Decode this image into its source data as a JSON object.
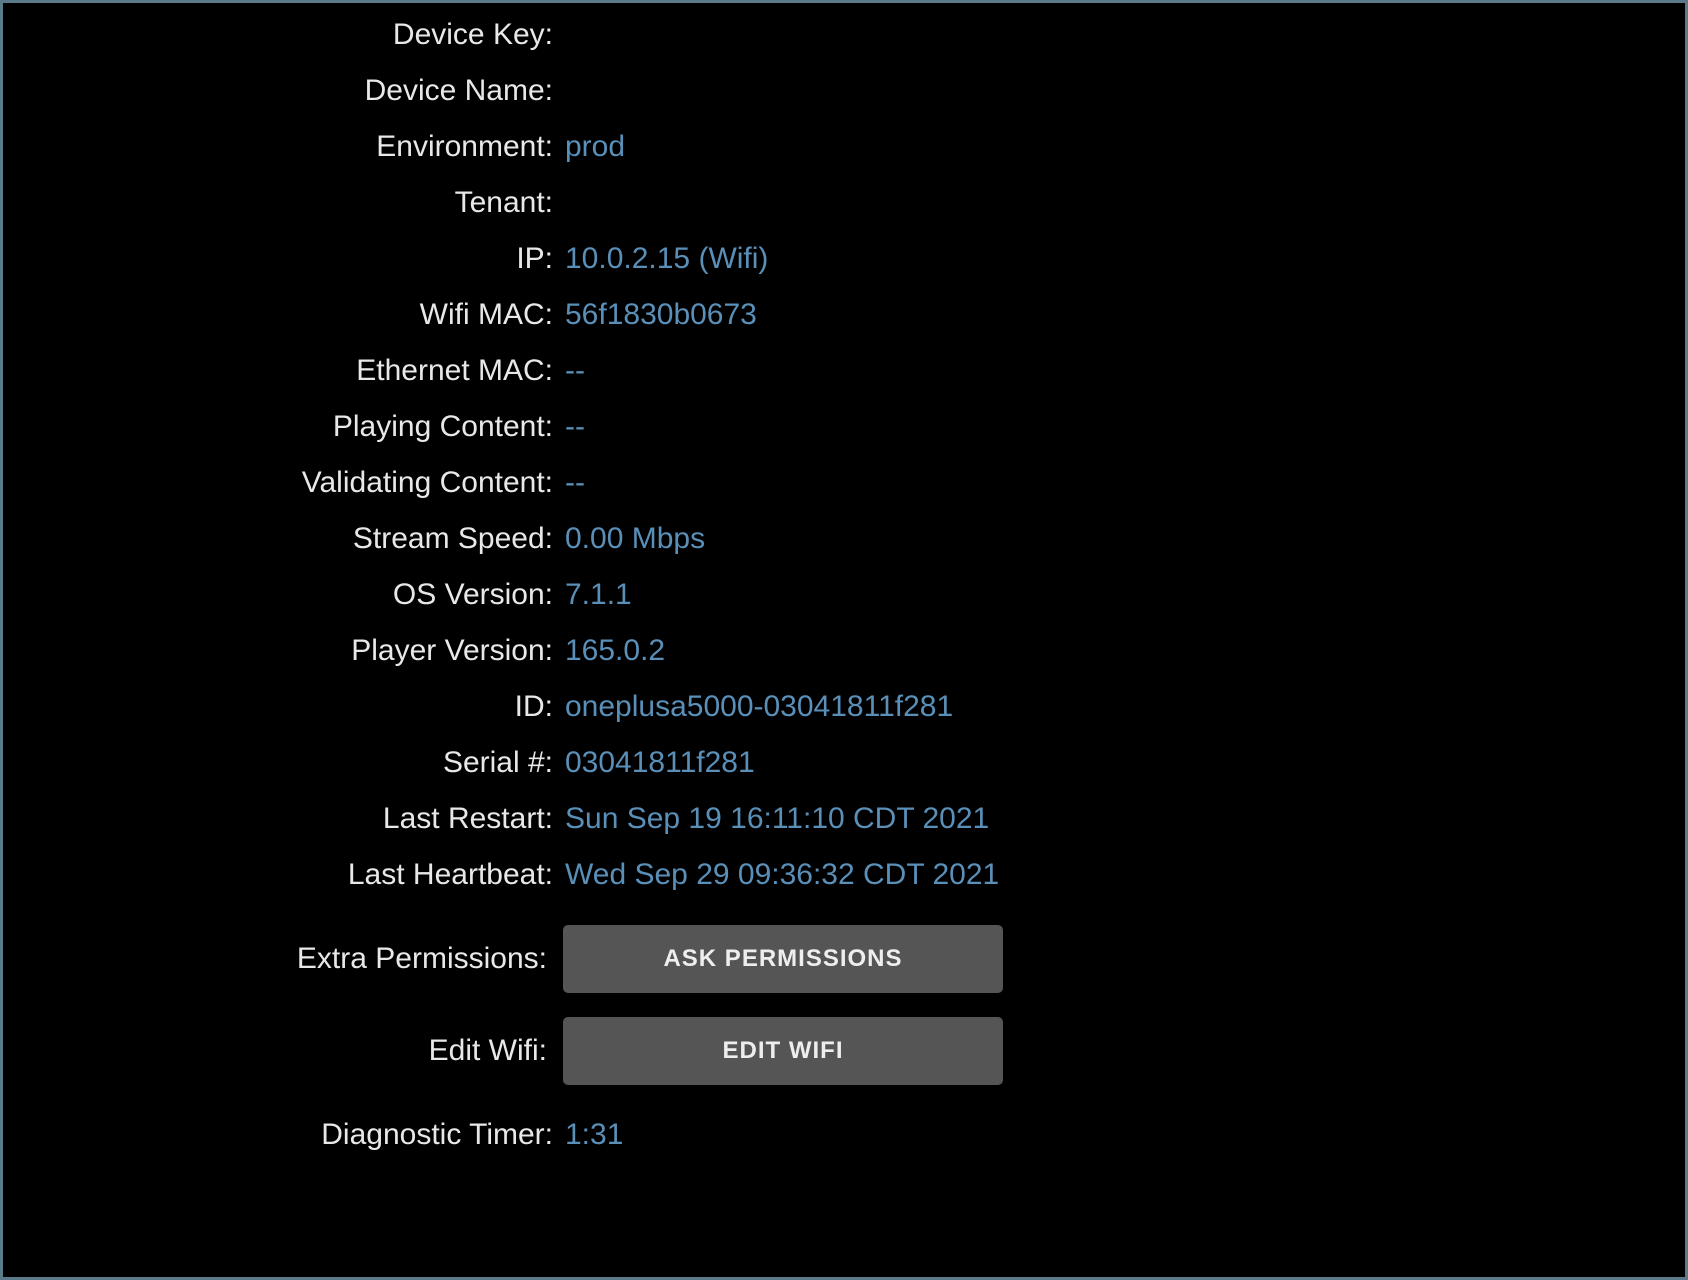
{
  "rows": {
    "device_key": {
      "label": "Device Key:",
      "value": ""
    },
    "device_name": {
      "label": "Device Name:",
      "value": ""
    },
    "environment": {
      "label": "Environment:",
      "value": "prod"
    },
    "tenant": {
      "label": "Tenant:",
      "value": ""
    },
    "ip": {
      "label": "IP:",
      "value": "10.0.2.15 (Wifi)"
    },
    "wifi_mac": {
      "label": "Wifi MAC:",
      "value": "56f1830b0673"
    },
    "ethernet_mac": {
      "label": "Ethernet MAC:",
      "value": "--"
    },
    "playing_content": {
      "label": "Playing Content:",
      "value": "--"
    },
    "validating_content": {
      "label": "Validating Content:",
      "value": "--"
    },
    "stream_speed": {
      "label": "Stream Speed:",
      "value": "0.00 Mbps"
    },
    "os_version": {
      "label": "OS Version:",
      "value": "7.1.1"
    },
    "player_version": {
      "label": "Player Version:",
      "value": "165.0.2"
    },
    "id": {
      "label": "ID:",
      "value": "oneplusa5000-03041811f281"
    },
    "serial": {
      "label": "Serial #:",
      "value": "03041811f281"
    },
    "last_restart": {
      "label": "Last Restart:",
      "value": "Sun Sep 19 16:11:10 CDT 2021"
    },
    "last_heartbeat": {
      "label": "Last Heartbeat:",
      "value": "Wed Sep 29 09:36:32 CDT 2021"
    }
  },
  "actions": {
    "extra_permissions": {
      "label": "Extra Permissions:",
      "button": "ASK PERMISSIONS"
    },
    "edit_wifi": {
      "label": "Edit Wifi:",
      "button": "EDIT WIFI"
    }
  },
  "diagnostic_timer": {
    "label": "Diagnostic Timer:",
    "value": "1:31"
  }
}
